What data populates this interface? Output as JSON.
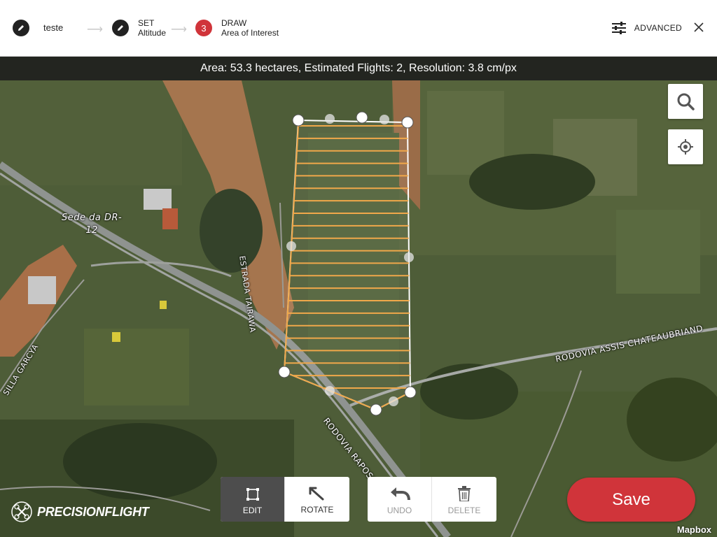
{
  "wizard": {
    "step1": {
      "label": "teste",
      "icon": "pencil-icon"
    },
    "step2": {
      "title": "SET",
      "subtitle": "Altitude",
      "icon": "pencil-icon"
    },
    "step3": {
      "number": "3",
      "title": "DRAW",
      "subtitle": "Area of Interest"
    },
    "advanced_label": "ADVANCED",
    "close_icon": "close-icon"
  },
  "info": {
    "text": "Area: 53.3 hectares, Estimated Flights: 2, Resolution: 3.8 cm/px"
  },
  "map": {
    "labels": {
      "place": "Sede da DR-",
      "place2": "12",
      "road1": "ESTRADA TAIRAWA",
      "road2": "RODOVIA ASSIS CHATEAUBRIAND",
      "road3": "RODOVIA RAPOSO",
      "road4": "SILLA GARCYA"
    },
    "attribution": "Mapbox"
  },
  "toolbar": {
    "edit": "EDIT",
    "rotate": "ROTATE",
    "undo": "UNDO",
    "delete": "DELETE"
  },
  "save_label": "Save",
  "brand": "PRECISIONFLIGHT",
  "colors": {
    "accent": "#d0343a",
    "flight_lines": "#f0a84a",
    "active_tool": "#4d4d4d"
  }
}
